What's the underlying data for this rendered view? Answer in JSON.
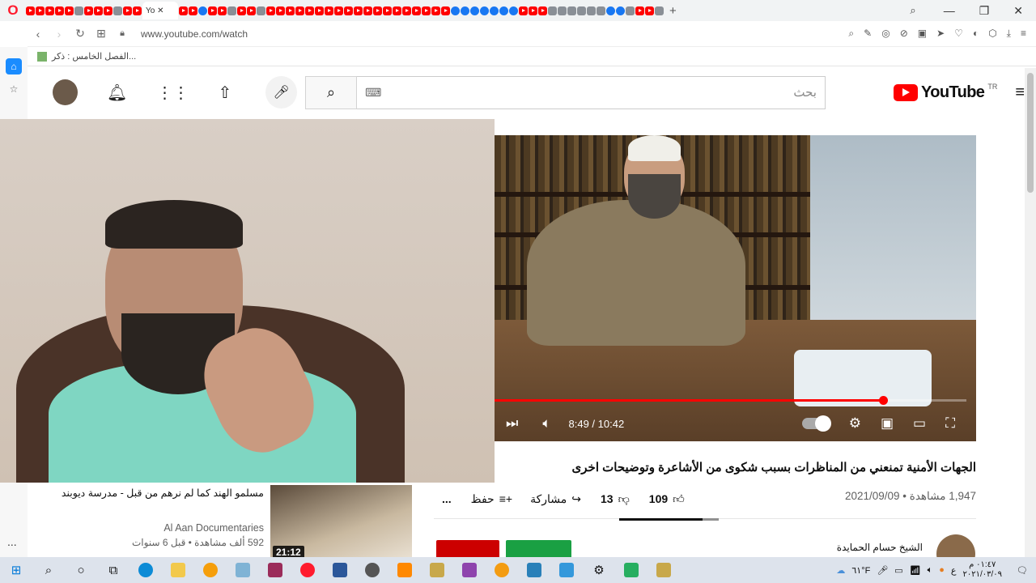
{
  "browser": {
    "active_tab_label": "Yo",
    "url": "www.youtube.com/watch",
    "bookmark": "الفصل الخامس : ذكر...",
    "window_controls": [
      "—",
      "❐",
      "✕"
    ]
  },
  "youtube": {
    "search_placeholder": "بحث",
    "logo_text": "YouTube",
    "country_code": "TR"
  },
  "player": {
    "time": "8:49 / 10:42",
    "progress_fraction": 0.824
  },
  "video": {
    "title": "الجهات الأمنية تمنعني من المناظرات بسبب شكوى من الأشاعرة وتوضيحات اخرى",
    "views_date": "1,947 مشاهدة • 2021/09/09",
    "likes": "109",
    "dislikes": "13",
    "share_label": "مشاركة",
    "save_label": "حفظ",
    "more_label": "..."
  },
  "channel": {
    "name": "الشيخ حسام الحمايدة"
  },
  "related": {
    "title": "مسلمو الهند كما لم نرهم من قبل - مدرسة ديوبند",
    "channel": "Al Aan Documentaries",
    "meta": "592 ألف مشاهدة • قبل 6 سنوات",
    "duration": "21:12",
    "more_label": "..."
  },
  "taskbar": {
    "temperature": "٦١°F",
    "lang": "ع",
    "time": "٠١:٤٧ م",
    "date": "٢٠٢١/٠٣/٠٩"
  },
  "colors": {
    "youtube_red": "#ff0000",
    "progress_red": "#ff0000",
    "join_green": "#1aa043",
    "subscribe_red": "#cc0000",
    "taskbar": "#dde3ec"
  }
}
